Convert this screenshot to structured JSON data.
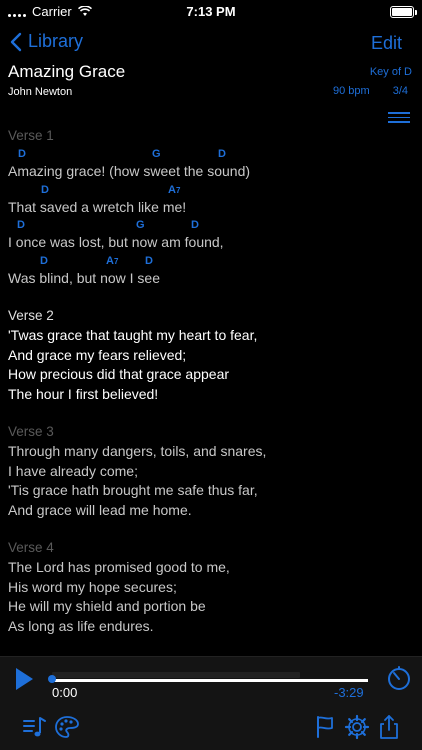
{
  "status_bar": {
    "carrier": "Carrier",
    "time": "7:13 PM"
  },
  "nav": {
    "back_label": "Library",
    "edit_label": "Edit"
  },
  "song": {
    "title": "Amazing Grace",
    "author": "John Newton",
    "key": "Key of D",
    "bpm": "90 bpm",
    "time_signature": "3/4"
  },
  "verses": [
    {
      "label": "Verse 1",
      "lines": [
        {
          "chords": [
            {
              "name": "D"
            },
            {
              "name": "G"
            },
            {
              "name": "D"
            }
          ],
          "text": "Amazing grace! (how sweet the sound)"
        },
        {
          "chords": [
            {
              "name": "D"
            },
            {
              "name": "A",
              "sub": "7"
            }
          ],
          "text": "That saved a wretch like me!"
        },
        {
          "chords": [
            {
              "name": "D"
            },
            {
              "name": "G"
            },
            {
              "name": "D"
            }
          ],
          "text": "I once was lost, but now am found,"
        },
        {
          "chords": [
            {
              "name": "D"
            },
            {
              "name": "A",
              "sub": "7"
            },
            {
              "name": "D"
            }
          ],
          "text": "Was blind, but now I see"
        }
      ]
    },
    {
      "label": "Verse 2",
      "lines": [
        "'Twas grace that taught my heart to fear,",
        "And grace my fears relieved;",
        "How precious did that grace appear",
        "The hour I first believed!"
      ]
    },
    {
      "label": "Verse 3",
      "lines": [
        "Through many dangers, toils, and snares,",
        "I have already come;",
        "'Tis grace hath brought me safe thus far,",
        "And grace will lead me home."
      ]
    },
    {
      "label": "Verse 4",
      "lines": [
        "The Lord has promised good to me,",
        "His word my hope secures;",
        "He will my shield and portion be",
        "As long as life endures."
      ]
    }
  ],
  "player": {
    "elapsed": "0:00",
    "remaining": "-3:29",
    "progress": 0.0
  },
  "colors": {
    "accent": "#1e6fd9",
    "background": "#000000",
    "muted": "#5a5a5a"
  },
  "icons": {
    "play": "play-icon",
    "timer": "timer-icon",
    "playlist": "playlist-icon",
    "palette": "palette-icon",
    "flag": "flag-icon",
    "settings": "gear-icon",
    "share": "share-icon",
    "menu": "menu-icon"
  }
}
